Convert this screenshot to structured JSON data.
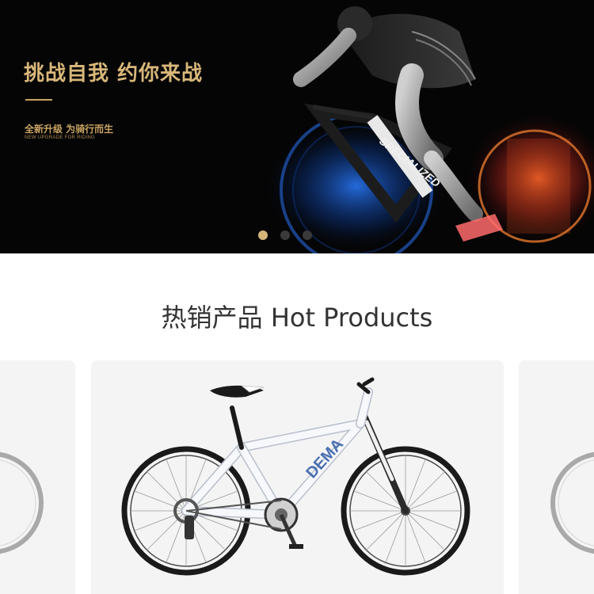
{
  "banner": {
    "headline": "挑战自我 约你来战",
    "subtitle_cn": "全新升级 为骑行而生",
    "subtitle_en": "NEW UPGRADE FOR RIDING",
    "frame_brand": "SPECIALIZED",
    "dots_total": 3,
    "dots_active_index": 0
  },
  "hot_products": {
    "title": "热销产品 Hot Products",
    "items": [
      {
        "name": "",
        "brand_mark": ""
      },
      {
        "name": "",
        "brand_mark": "DEMA"
      },
      {
        "name": "",
        "brand_mark": ""
      }
    ]
  },
  "colors": {
    "gold": "#d9b77a",
    "banner_bg": "#050505",
    "card_bg": "#f4f4f4",
    "title_text": "#333333"
  }
}
